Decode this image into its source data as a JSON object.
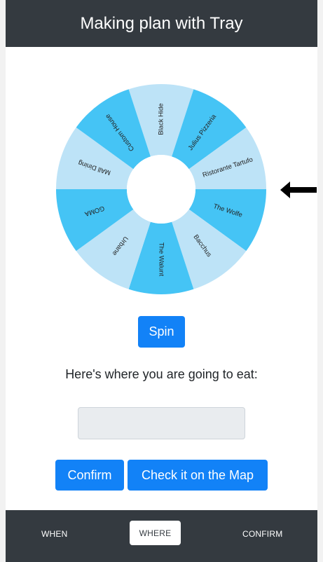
{
  "header": {
    "title": "Making plan with Tray"
  },
  "wheel": {
    "segments": [
      {
        "label": "Black Hide",
        "color": "#bde3f7"
      },
      {
        "label": "Julius Pizzeria",
        "color": "#45c4f5"
      },
      {
        "label": "Ristorante Tartufo",
        "color": "#bde3f7"
      },
      {
        "label": "The Wolfe",
        "color": "#45c4f5"
      },
      {
        "label": "Bacchus",
        "color": "#bde3f7"
      },
      {
        "label": "The Walunt",
        "color": "#45c4f5"
      },
      {
        "label": "Urbane",
        "color": "#bde3f7"
      },
      {
        "label": "GOMA",
        "color": "#45c4f5"
      },
      {
        "label": "MAll Dining",
        "color": "#bde3f7"
      },
      {
        "label": "Custom House",
        "color": "#45c4f5"
      }
    ],
    "pointer_icon": "arrow-left-icon"
  },
  "actions": {
    "spin_label": "Spin",
    "confirm_label": "Confirm",
    "map_label": "Check it on the Map"
  },
  "result": {
    "label": "Here's where you are going to eat:",
    "value": ""
  },
  "footer": {
    "tabs": [
      {
        "label": "WHEN",
        "active": false
      },
      {
        "label": "WHERE",
        "active": true
      },
      {
        "label": "CONFIRM",
        "active": false
      }
    ]
  },
  "colors": {
    "header_bg": "#343a40",
    "primary": "#1282f7",
    "wheel_light": "#bde3f7",
    "wheel_dark": "#45c4f5"
  }
}
